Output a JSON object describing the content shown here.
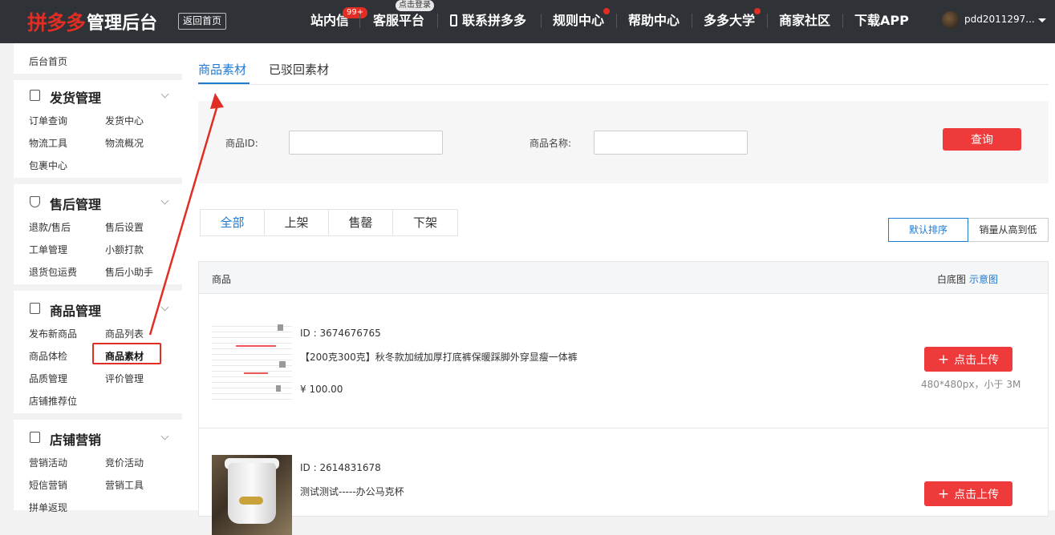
{
  "header": {
    "logo_brand": "拼多多",
    "logo_rest": "管理后台",
    "back_home": "返回首页",
    "nav": [
      {
        "label": "站内信",
        "badge": "99+"
      },
      {
        "label": "客服平台",
        "badge": "点击登录"
      },
      {
        "label": "联系拼多多",
        "icon": "phone-icon"
      },
      {
        "label": "规则中心",
        "dot": true
      },
      {
        "label": "帮助中心"
      },
      {
        "label": "多多大学",
        "dot": true
      },
      {
        "label": "商家社区"
      },
      {
        "label": "下载APP"
      }
    ],
    "username": "pdd2011297..."
  },
  "sidebar": {
    "home": "后台首页",
    "sections": [
      {
        "title": "发货管理",
        "icon": "document-icon",
        "items": [
          "订单查询",
          "发货中心",
          "物流工具",
          "物流概况",
          "包裹中心"
        ]
      },
      {
        "title": "售后管理",
        "icon": "shield-icon",
        "items": [
          "退款/售后",
          "售后设置",
          "工单管理",
          "小额打款",
          "退货包运费",
          "售后小助手"
        ]
      },
      {
        "title": "商品管理",
        "icon": "bag-icon",
        "items": [
          "发布新商品",
          "商品列表",
          "商品体检",
          "商品素材",
          "品质管理",
          "评价管理",
          "店铺推荐位"
        ],
        "active": "商品素材"
      },
      {
        "title": "店铺营销",
        "icon": "gift-icon",
        "items": [
          "营销活动",
          "竞价活动",
          "短信营销",
          "营销工具",
          "拼单返现"
        ]
      }
    ]
  },
  "main": {
    "tabs": [
      "商品素材",
      "已驳回素材"
    ],
    "filters": {
      "id_label": "商品ID:",
      "name_label": "商品名称:",
      "query_label": "查询"
    },
    "status_tabs": [
      "全部",
      "上架",
      "售罄",
      "下架"
    ],
    "sort": [
      "默认排序",
      "销量从高到低"
    ],
    "table": {
      "col_product": "商品",
      "col_white": "白底图",
      "col_sample": "示意图"
    },
    "rows": [
      {
        "id": "ID : 3674676765",
        "name": "【200克300克】秋冬款加绒加厚打底裤保暖踩脚外穿显瘦一体裤",
        "price": "¥ 100.00",
        "upload": "点击上传",
        "hint": "480*480px，小于 3M"
      },
      {
        "id": "ID : 2614831678",
        "name": "测试测试-----办公马克杯",
        "upload": "点击上传"
      }
    ]
  },
  "colors": {
    "brand_red": "#e02e24",
    "link_blue": "#1f7ad1",
    "nav_bg": "#2f3237"
  }
}
